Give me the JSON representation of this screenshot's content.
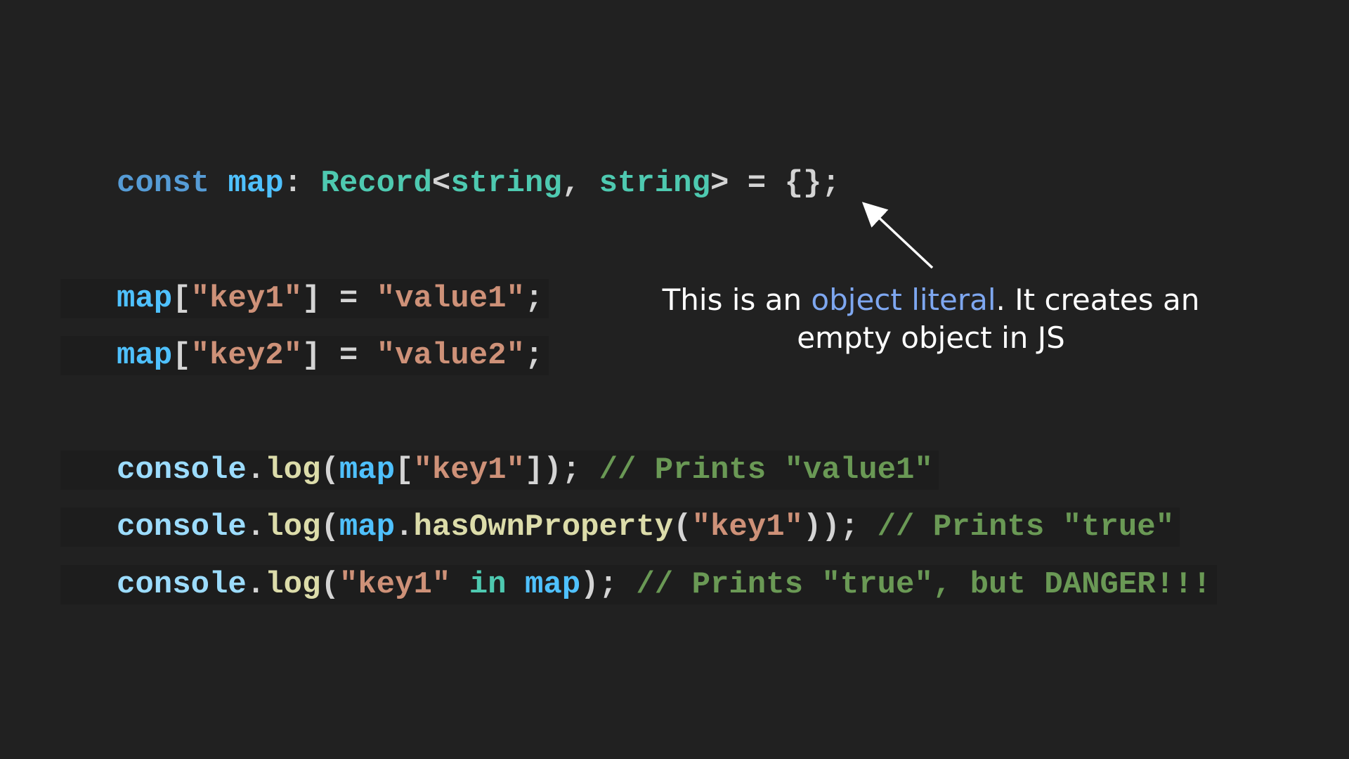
{
  "code": {
    "line1": {
      "kw": "const",
      "var": "map",
      "colon": ":",
      "type": "Record",
      "lt": "<",
      "arg1": "string",
      "comma": ",",
      "arg2": "string",
      "rest": "> = {};"
    },
    "line2": {
      "var": "map",
      "open": "[",
      "key": "\"key1\"",
      "mid": "] = ",
      "value": "\"value1\"",
      "end": ";"
    },
    "line3": {
      "var": "map",
      "open": "[",
      "key": "\"key2\"",
      "mid": "] = ",
      "value": "\"value2\"",
      "end": ";"
    },
    "line4": {
      "obj": "console",
      "dot": ".",
      "fn": "log",
      "open": "(",
      "var": "map",
      "bracket": "[",
      "key": "\"key1\"",
      "close": "]);",
      "comment": "// Prints \"value1\""
    },
    "line5": {
      "obj": "console",
      "dot": ".",
      "fn": "log",
      "open": "(",
      "var": "map",
      "dot2": ".",
      "method": "hasOwnProperty",
      "open2": "(",
      "key": "\"key1\"",
      "close": "));",
      "comment": "// Prints \"true\""
    },
    "line6": {
      "obj": "console",
      "dot": ".",
      "fn": "log",
      "open": "(",
      "key": "\"key1\"",
      "op": "in",
      "var": "map",
      "close": ");",
      "comment": "// Prints \"true\", but DANGER!!!"
    }
  },
  "annotation": {
    "before": "This is an ",
    "highlight": "object literal",
    "after": ". It creates an empty object in JS"
  },
  "colors": {
    "background": "#212121",
    "keyword": "#569cd6",
    "variable": "#4fc1ff",
    "type": "#4ec9b0",
    "string": "#ce9178",
    "function": "#dcdcaa",
    "comment": "#6a9955",
    "highlight": "#7ea7f0"
  }
}
